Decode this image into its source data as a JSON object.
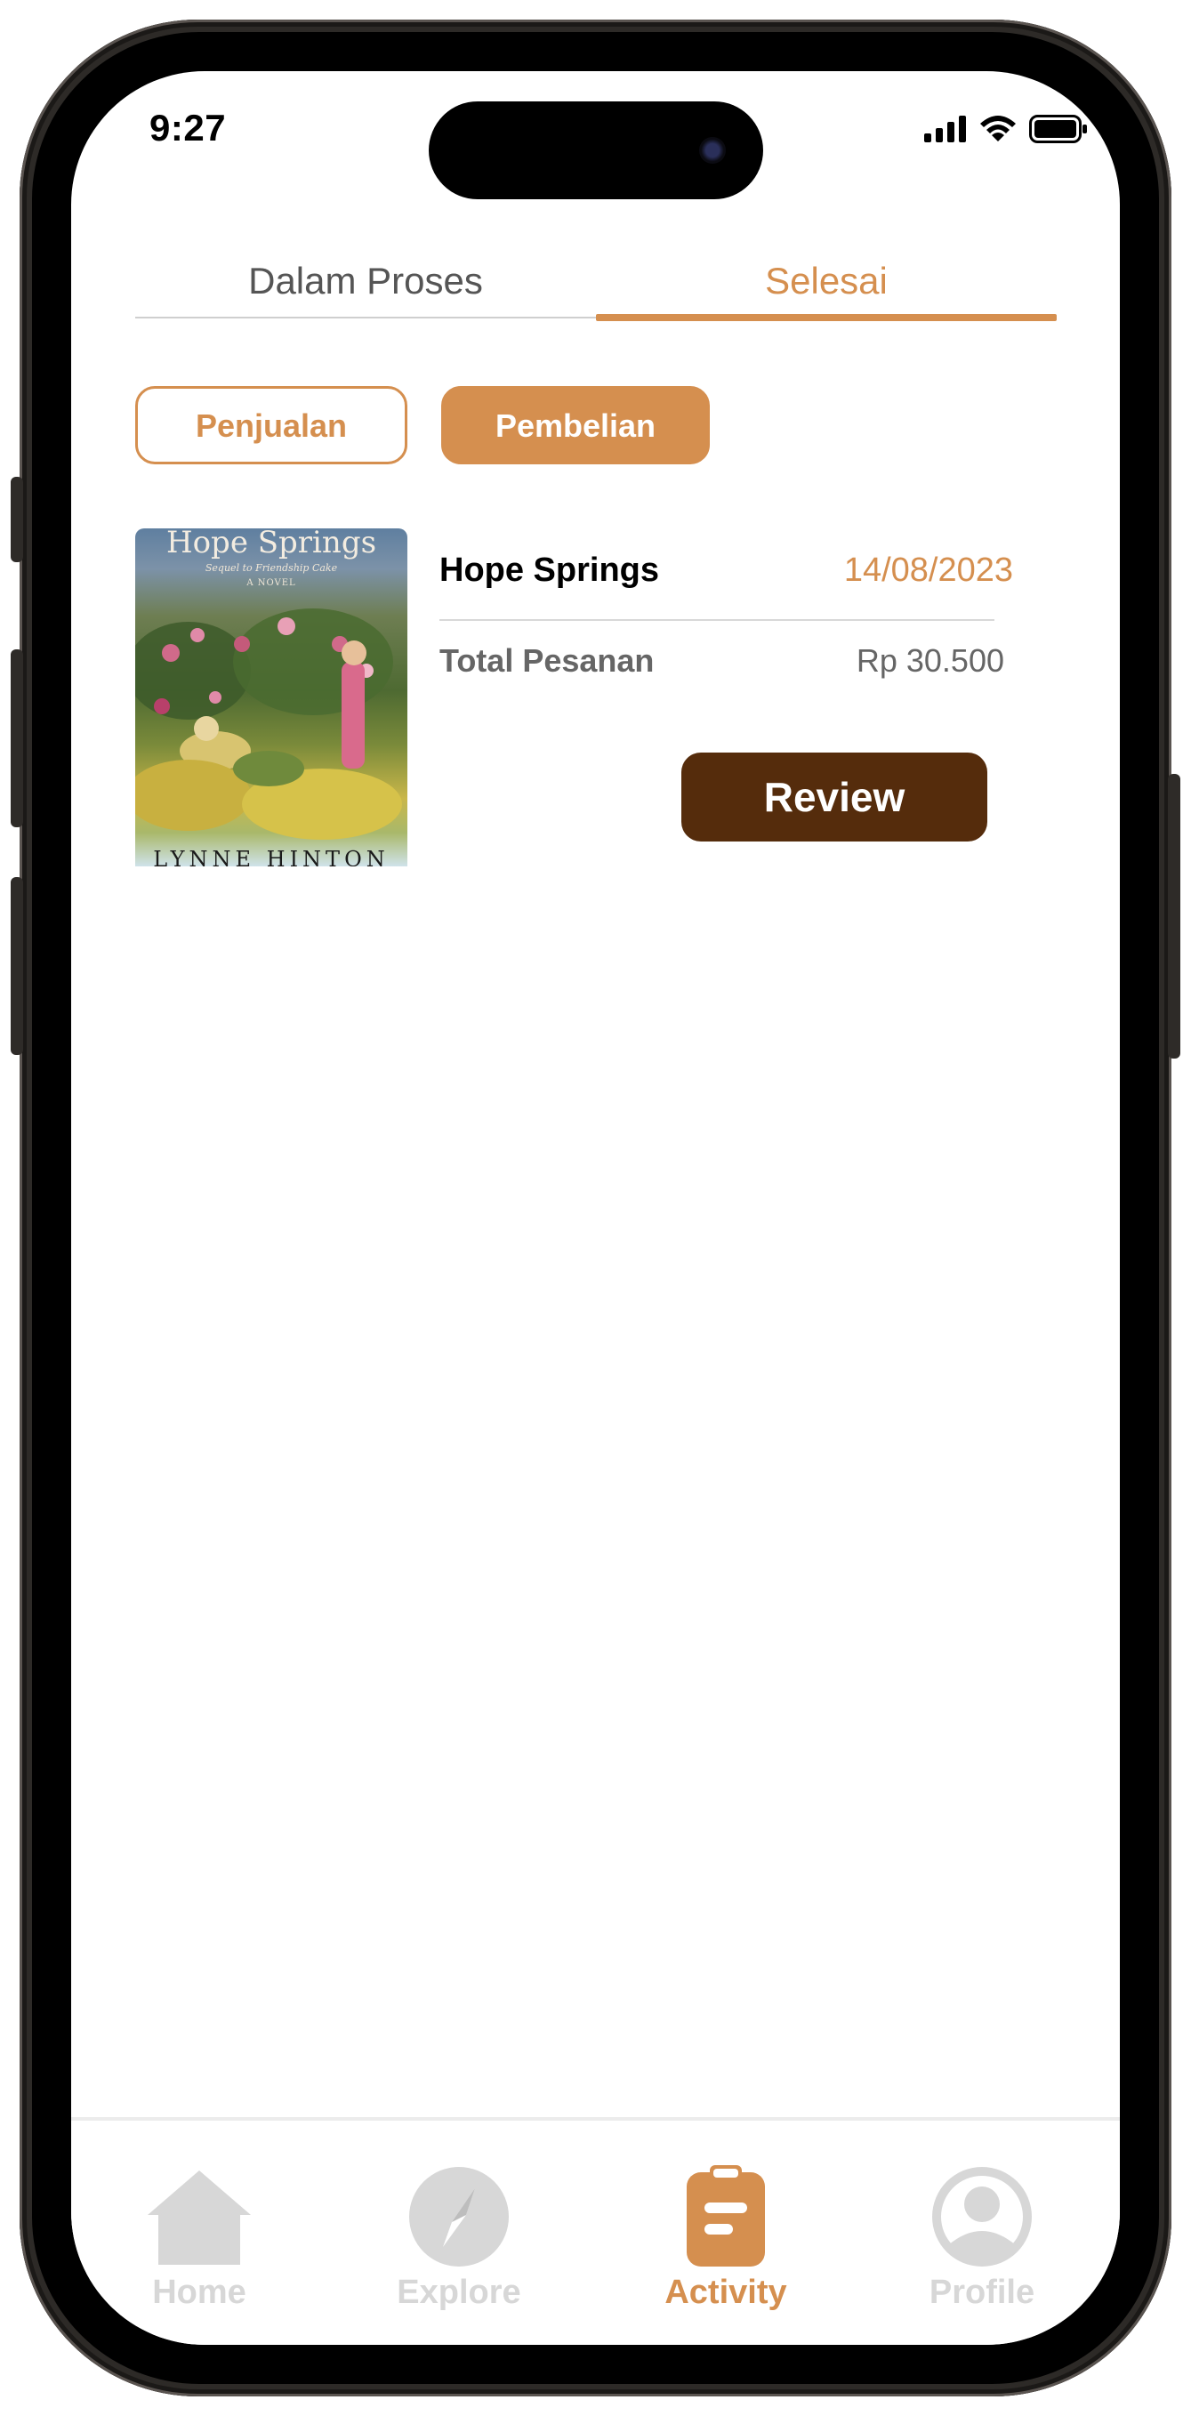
{
  "status_bar": {
    "time": "9:27"
  },
  "tabs": [
    {
      "label": "Dalam Proses",
      "active": false
    },
    {
      "label": "Selesai",
      "active": true
    }
  ],
  "segments": [
    {
      "label": "Penjualan",
      "selected": false
    },
    {
      "label": "Pembelian",
      "selected": true
    }
  ],
  "order": {
    "cover": {
      "title": "Hope Springs",
      "subtitle": "Sequel to Friendship Cake",
      "novel_tag": "A NOVEL",
      "author": "LYNNE HINTON"
    },
    "title": "Hope Springs",
    "date": "14/08/2023",
    "total_label": "Total Pesanan",
    "total_value": "Rp 30.500",
    "review_label": "Review"
  },
  "bottom_nav": [
    {
      "label": "Home",
      "icon": "home-icon",
      "active": false
    },
    {
      "label": "Explore",
      "icon": "compass-icon",
      "active": false
    },
    {
      "label": "Activity",
      "icon": "clipboard-icon",
      "active": true
    },
    {
      "label": "Profile",
      "icon": "profile-icon",
      "active": false
    }
  ],
  "colors": {
    "accent": "#d58f4f",
    "review_button": "#552c0c",
    "inactive_nav": "#d7d7d7"
  }
}
